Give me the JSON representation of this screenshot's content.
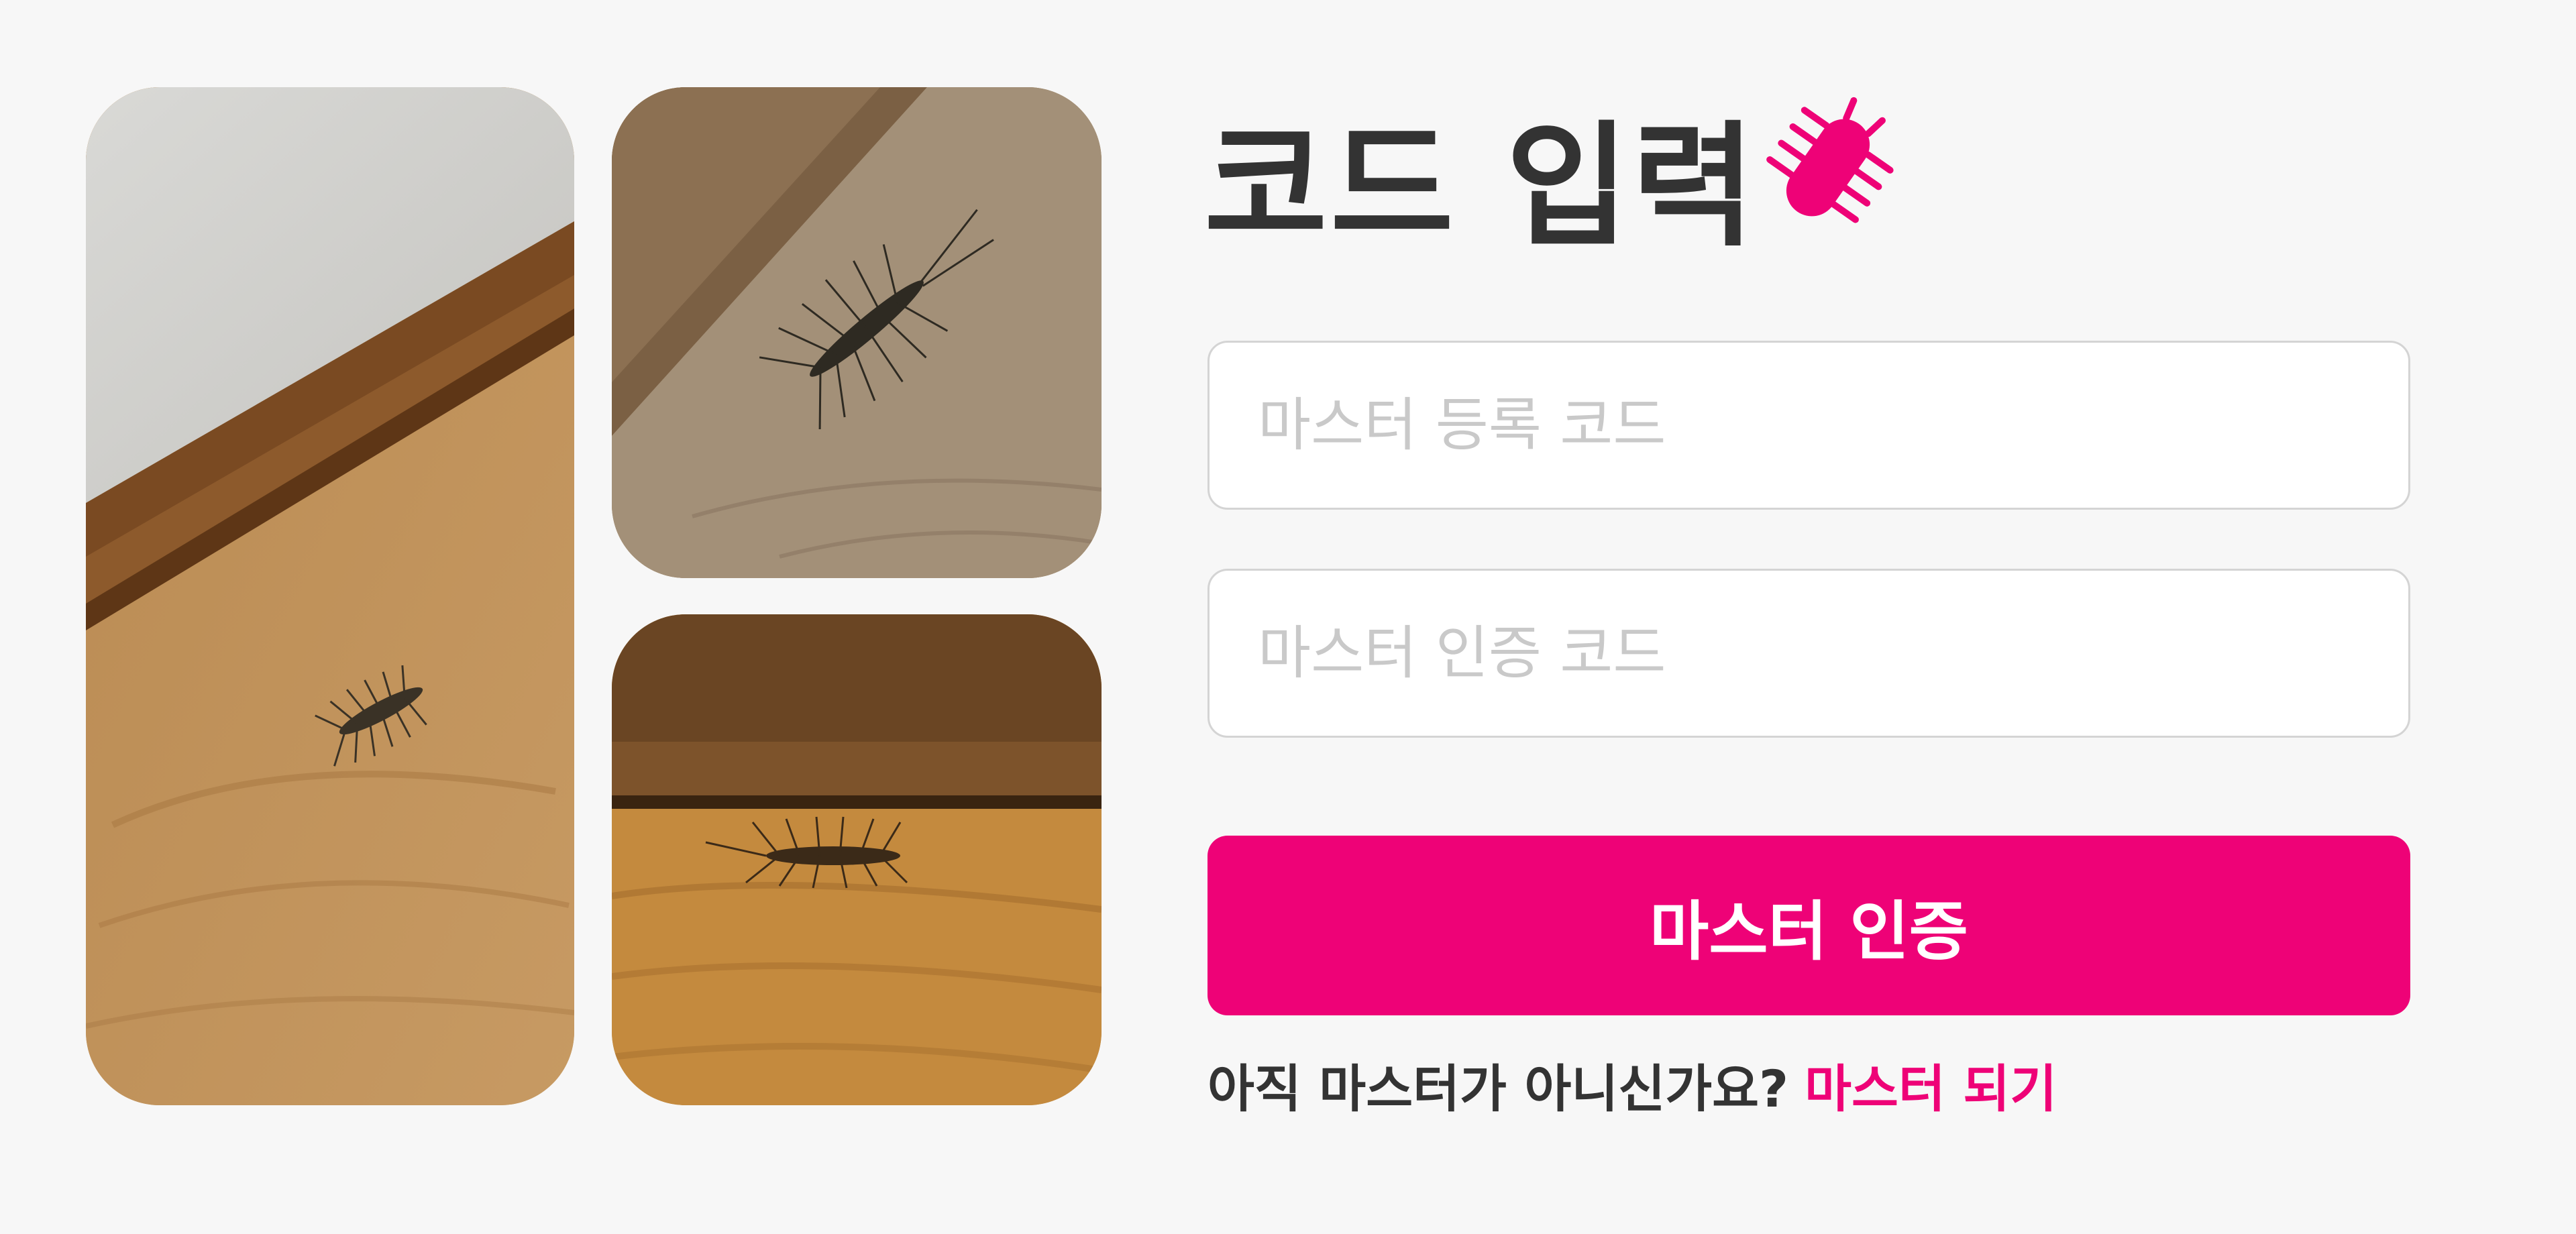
{
  "header": {
    "title": "코드 입력",
    "icon": "bug-icon"
  },
  "form": {
    "register_code_placeholder": "마스터 등록 코드",
    "auth_code_placeholder": "마스터 인증 코드",
    "submit_label": "마스터 인증"
  },
  "footer": {
    "question": "아직 마스터가 아니신가요?",
    "link_label": "마스터 되기"
  },
  "colors": {
    "accent": "#ee0277",
    "text": "#333333",
    "background": "#f7f7f7",
    "placeholder": "#c9c9c9"
  },
  "photos": [
    {
      "name": "house-centipede-photo-baseboard-corner"
    },
    {
      "name": "house-centipede-photo-floor"
    },
    {
      "name": "house-centipede-photo-under-baseboard"
    }
  ]
}
